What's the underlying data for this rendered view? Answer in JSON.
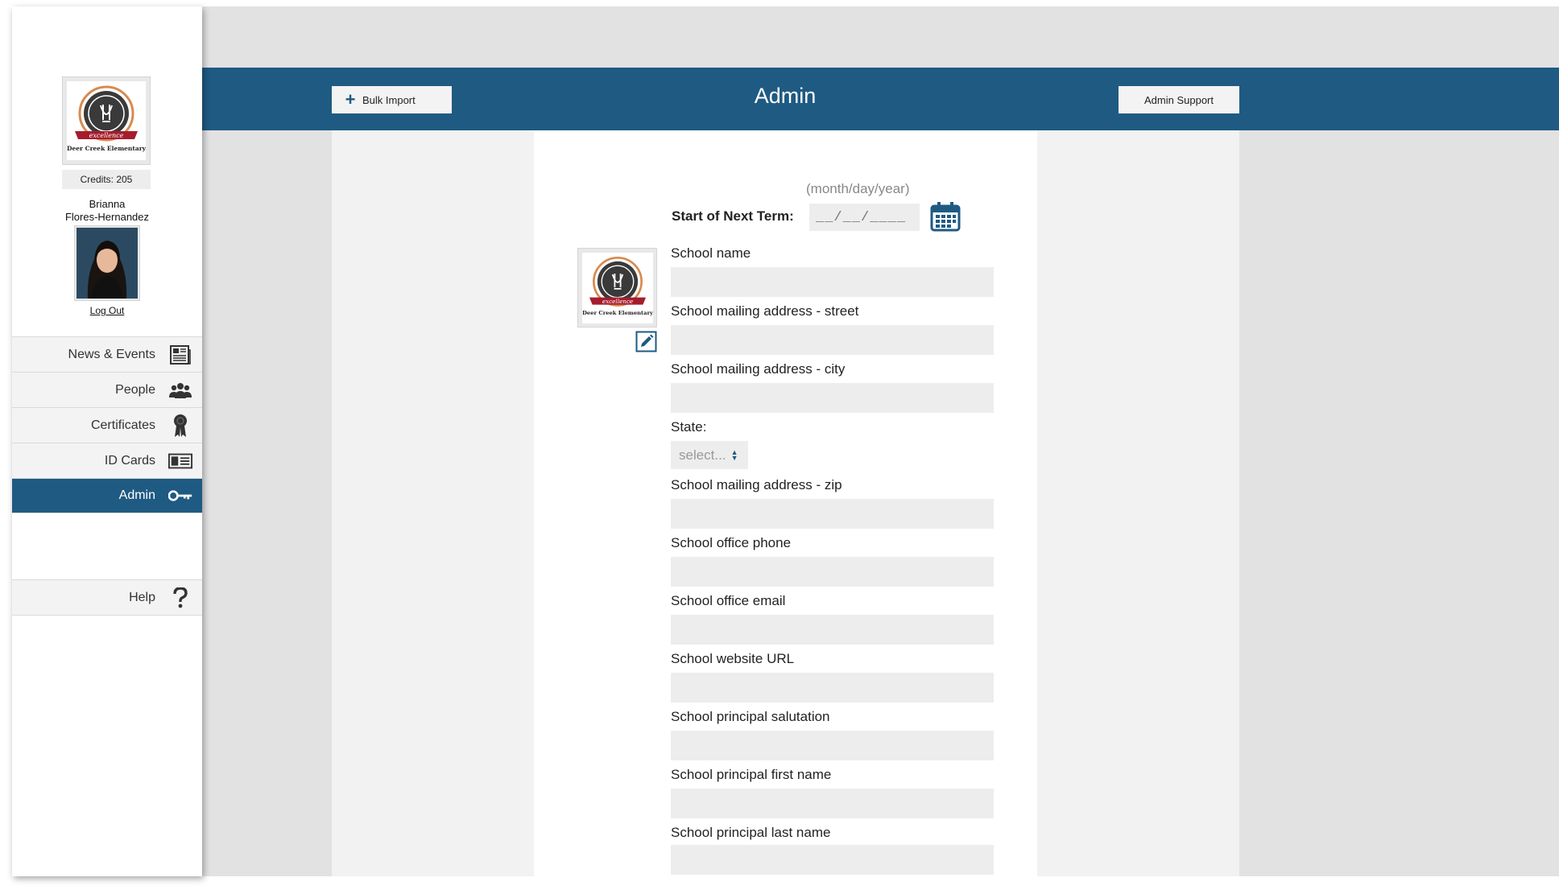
{
  "sidebar": {
    "school_logo_text": "Deer Creek Elementary",
    "logo_banner": "excellence",
    "credits": "Credits: 205",
    "user_first": "Brianna",
    "user_last": "Flores-Hernandez",
    "logout": "Log Out",
    "nav": [
      {
        "label": "News & Events",
        "icon": "newspaper-icon"
      },
      {
        "label": "People",
        "icon": "people-icon"
      },
      {
        "label": "Certificates",
        "icon": "ribbon-icon"
      },
      {
        "label": "ID Cards",
        "icon": "id-card-icon"
      },
      {
        "label": "Admin",
        "icon": "key-icon",
        "active": true
      }
    ],
    "help": {
      "label": "Help",
      "icon": "question-icon"
    }
  },
  "header": {
    "title": "Admin",
    "bulk_import": "Bulk Import",
    "admin_support": "Admin Support"
  },
  "form": {
    "date_hint": "(month/day/year)",
    "term_label": "Start of Next Term:",
    "date_placeholder": "__/__/____",
    "state_label": "State:",
    "state_value": "select...",
    "fields": [
      {
        "label": "School name",
        "value": ""
      },
      {
        "label": "School mailing address - street",
        "value": ""
      },
      {
        "label": "School mailing address - city",
        "value": ""
      },
      {
        "label": "School mailing address - zip",
        "value": ""
      },
      {
        "label": "School office phone",
        "value": ""
      },
      {
        "label": "School office email",
        "value": ""
      },
      {
        "label": "School website URL",
        "value": ""
      },
      {
        "label": "School principal salutation",
        "value": ""
      },
      {
        "label": "School principal first name",
        "value": ""
      },
      {
        "label": "School principal last name",
        "value": ""
      }
    ]
  },
  "colors": {
    "brand": "#1f5a82",
    "panel": "#f2f2f2",
    "input": "#ededed"
  }
}
